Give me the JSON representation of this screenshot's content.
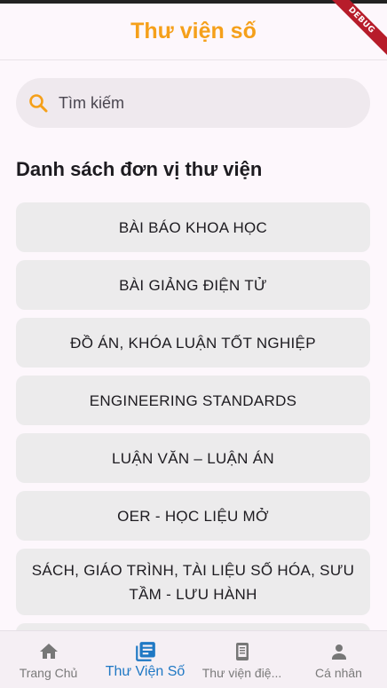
{
  "appbar": {
    "title": "Thư viện số",
    "debug_label": "DEBUG"
  },
  "search": {
    "placeholder": "Tìm kiếm",
    "value": ""
  },
  "section": {
    "title": "Danh sách đơn vị thư viện"
  },
  "categories": [
    {
      "label": "BÀI BÁO KHOA HỌC"
    },
    {
      "label": "BÀI GIẢNG ĐIỆN TỬ"
    },
    {
      "label": "ĐỒ ÁN, KHÓA LUẬN TỐT NGHIỆP"
    },
    {
      "label": "ENGINEERING STANDARDS"
    },
    {
      "label": "LUẬN VĂN – LUẬN ÁN"
    },
    {
      "label": "OER - HỌC LIỆU MỞ"
    },
    {
      "label": "SÁCH, GIÁO TRÌNH, TÀI LIỆU SỐ HÓA, SƯU TẦM - LƯU HÀNH"
    }
  ],
  "bottom_nav": {
    "items": [
      {
        "label": "Trang Chủ",
        "icon": "home-icon",
        "active": false
      },
      {
        "label": "Thư Viện Số",
        "icon": "library-books-icon",
        "active": true
      },
      {
        "label": "Thư viện điệ...",
        "icon": "ebook-reader-icon",
        "active": false
      },
      {
        "label": "Cá nhân",
        "icon": "person-icon",
        "active": false
      }
    ]
  },
  "colors": {
    "accent": "#f5a01a",
    "active_nav": "#1f78c4",
    "inactive_nav": "#7a7a7a",
    "background": "#fdf7fc",
    "card": "#ecebec"
  }
}
